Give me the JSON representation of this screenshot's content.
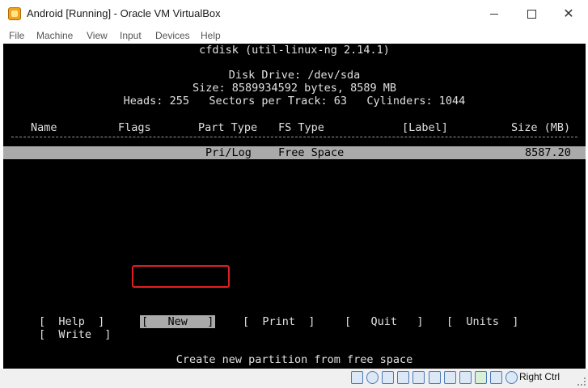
{
  "window": {
    "title": "Android [Running] - Oracle VM VirtualBox"
  },
  "menu": [
    "File",
    "Machine",
    "View",
    "Input",
    "Devices",
    "Help"
  ],
  "cfdisk": {
    "header": "cfdisk (util-linux-ng 2.14.1)",
    "disk_drive": "Disk Drive: /dev/sda",
    "size": "Size: 8589934592 bytes, 8589 MB",
    "geometry": "Heads: 255   Sectors per Track: 63   Cylinders: 1044",
    "columns": {
      "name": "Name",
      "flags": "Flags",
      "part_type": "Part Type",
      "fs_type": "FS Type",
      "label": "[Label]",
      "size": "Size (MB)"
    },
    "rows": [
      {
        "part_type": "Pri/Log",
        "fs_type": "Free Space",
        "size": "8587.20"
      }
    ],
    "buttons": {
      "help": "[  Help  ]",
      "new": "[   New   ]",
      "print": "[  Print  ]",
      "quit": "[   Quit   ]",
      "units": "[  Units  ]",
      "write": "[  Write  ]"
    },
    "selected_button": "New",
    "status": "Create new partition from free space"
  },
  "statusbar": {
    "icons": [
      "hard-disk-icon",
      "optical-drive-icon",
      "audio-icon",
      "network-icon",
      "usb-icon",
      "shared-folders-icon",
      "display-icon",
      "video-capture-icon",
      "virtualization-icon",
      "arrow-down-icon"
    ],
    "host_key": "Right Ctrl"
  },
  "colors": {
    "highlight": "#e02020",
    "selected_row": "#aaaaaa",
    "screen": "#000000"
  }
}
